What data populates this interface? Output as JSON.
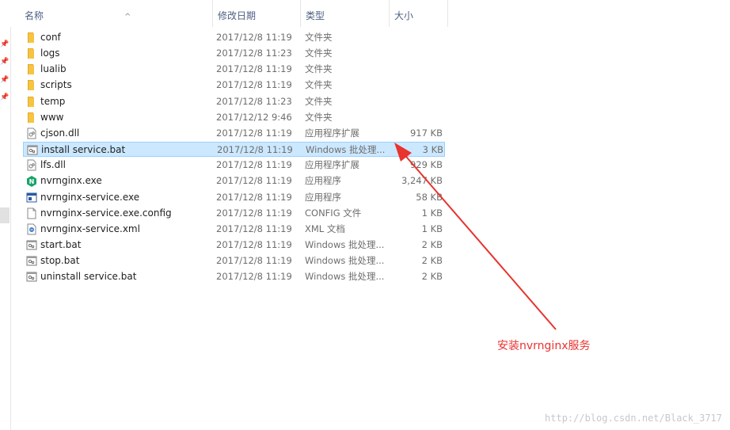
{
  "columns": {
    "name": "名称",
    "date": "修改日期",
    "type": "类型",
    "size": "大小"
  },
  "files": [
    {
      "name": "conf",
      "date": "2017/12/8 11:19",
      "type": "文件夹",
      "size": "",
      "icon": "folder-icon"
    },
    {
      "name": "logs",
      "date": "2017/12/8 11:23",
      "type": "文件夹",
      "size": "",
      "icon": "folder-icon"
    },
    {
      "name": "lualib",
      "date": "2017/12/8 11:19",
      "type": "文件夹",
      "size": "",
      "icon": "folder-icon"
    },
    {
      "name": "scripts",
      "date": "2017/12/8 11:19",
      "type": "文件夹",
      "size": "",
      "icon": "folder-icon"
    },
    {
      "name": "temp",
      "date": "2017/12/8 11:23",
      "type": "文件夹",
      "size": "",
      "icon": "folder-icon"
    },
    {
      "name": "www",
      "date": "2017/12/12 9:46",
      "type": "文件夹",
      "size": "",
      "icon": "folder-icon"
    },
    {
      "name": "cjson.dll",
      "date": "2017/12/8 11:19",
      "type": "应用程序扩展",
      "size": "917 KB",
      "icon": "dll-file-icon"
    },
    {
      "name": "install service.bat",
      "date": "2017/12/8 11:19",
      "type": "Windows 批处理...",
      "size": "3 KB",
      "icon": "batch-file-icon",
      "selected": true
    },
    {
      "name": "lfs.dll",
      "date": "2017/12/8 11:19",
      "type": "应用程序扩展",
      "size": "929 KB",
      "icon": "dll-file-icon"
    },
    {
      "name": "nvrnginx.exe",
      "date": "2017/12/8 11:19",
      "type": "应用程序",
      "size": "3,247 KB",
      "icon": "nginx-app-icon"
    },
    {
      "name": "nvrnginx-service.exe",
      "date": "2017/12/8 11:19",
      "type": "应用程序",
      "size": "58 KB",
      "icon": "exe-window-icon"
    },
    {
      "name": "nvrnginx-service.exe.config",
      "date": "2017/12/8 11:19",
      "type": "CONFIG 文件",
      "size": "1 KB",
      "icon": "blank-file-icon"
    },
    {
      "name": "nvrnginx-service.xml",
      "date": "2017/12/8 11:19",
      "type": "XML 文档",
      "size": "1 KB",
      "icon": "xml-file-icon"
    },
    {
      "name": "start.bat",
      "date": "2017/12/8 11:19",
      "type": "Windows 批处理...",
      "size": "2 KB",
      "icon": "batch-file-icon"
    },
    {
      "name": "stop.bat",
      "date": "2017/12/8 11:19",
      "type": "Windows 批处理...",
      "size": "2 KB",
      "icon": "batch-file-icon"
    },
    {
      "name": "uninstall service.bat",
      "date": "2017/12/8 11:19",
      "type": "Windows 批处理...",
      "size": "2 KB",
      "icon": "batch-file-icon"
    }
  ],
  "annotation": "安装nvrnginx服务",
  "watermark": "http://blog.csdn.net/Black_3717",
  "colors": {
    "selection_bg": "#cce8ff",
    "selection_border": "#99d1ff",
    "folder": "#f5c542",
    "annotation": "#e8332f",
    "header_text": "#4d6082"
  }
}
